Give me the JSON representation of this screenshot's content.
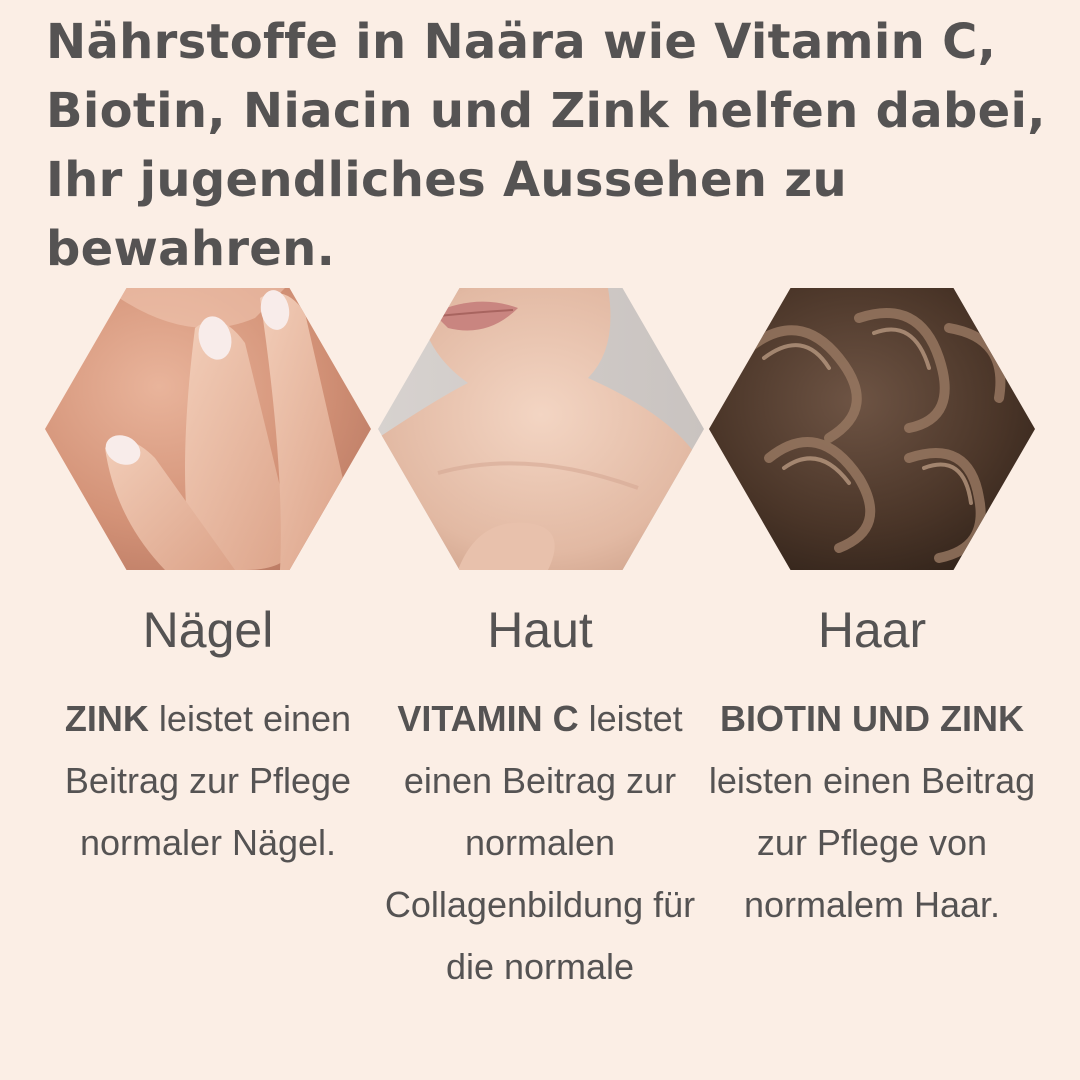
{
  "headline": "Nährstoffe in Naära wie Vitamin C, Biotin, Niacin und Zink helfen dabei, Ihr jugendliches Aussehen zu bewahren.",
  "columns": [
    {
      "title": "Nägel",
      "bold": "ZINK",
      "text": " leistet einen Beitrag zur Pflege normaler Nägel.",
      "image_icon": "fingernails-photo"
    },
    {
      "title": "Haut",
      "bold": "VITAMIN C",
      "text": " leistet einen Beitrag zur normalen Collagenbildung für die normale",
      "image_icon": "neck-skin-photo"
    },
    {
      "title": "Haar",
      "bold": "BIOTIN UND ZINK",
      "text": " leisten einen Beitrag zur Pflege von normalem Haar.",
      "image_icon": "curly-hair-photo"
    }
  ],
  "colors": {
    "background": "#fbeee5",
    "text": "#555353"
  }
}
